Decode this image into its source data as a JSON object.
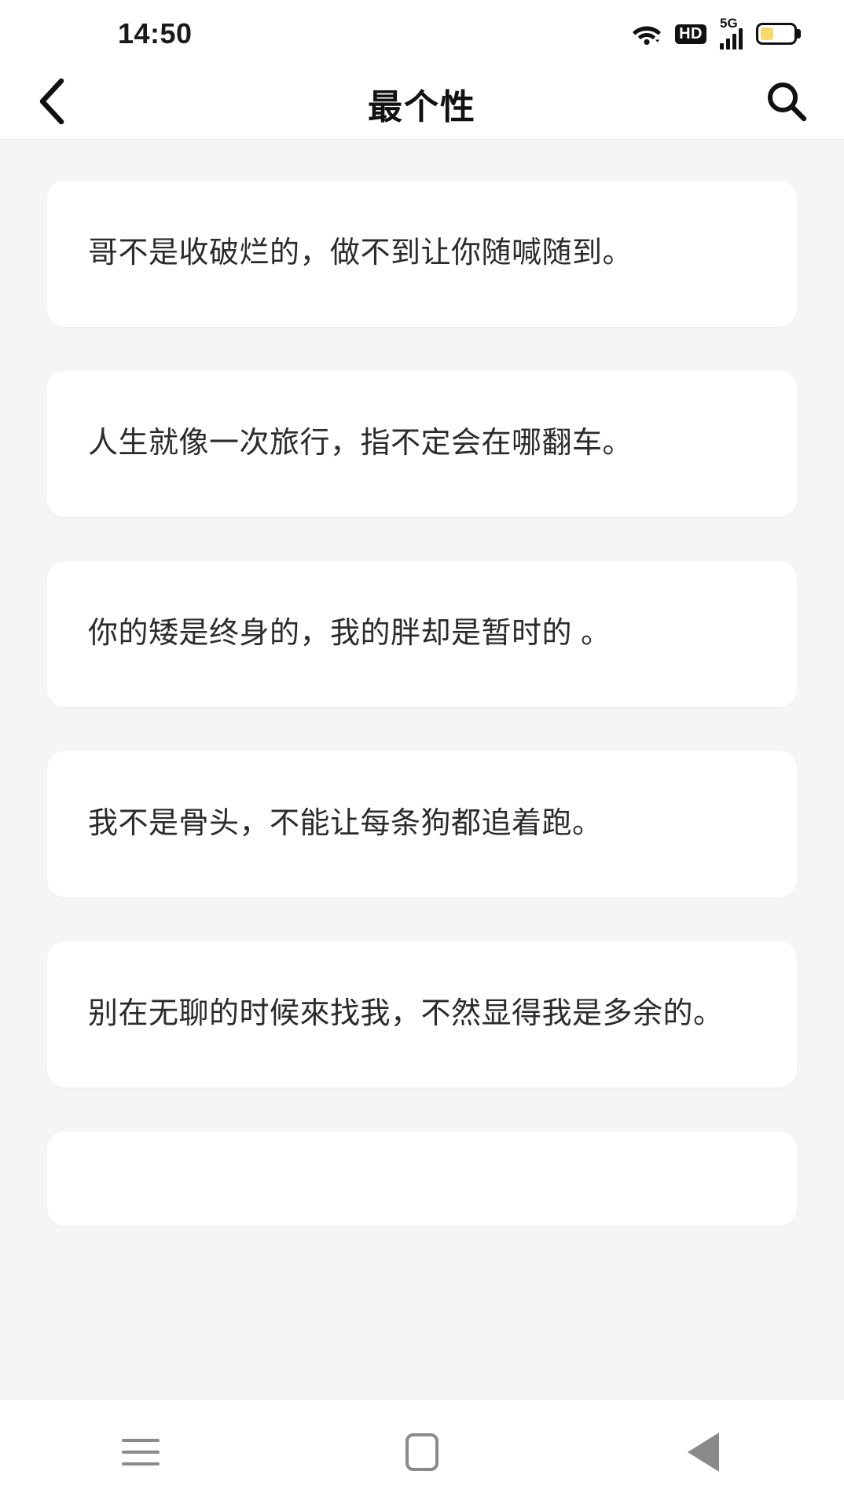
{
  "status_bar": {
    "time": "14:50",
    "icons": {
      "wifi": "wifi-icon",
      "hd": "HD",
      "network_label": "5G",
      "signal": "signal-bars-icon",
      "battery": "battery-icon",
      "battery_level_percent": 40
    }
  },
  "header": {
    "back_icon": "chevron-left-icon",
    "title": "最个性",
    "search_icon": "search-icon"
  },
  "list": {
    "items": [
      {
        "text": "哥不是收破烂的，做不到让你随喊随到。"
      },
      {
        "text": "人生就像一次旅行，指不定会在哪翻车。"
      },
      {
        "text": "你的矮是终身的，我的胖却是暂时的 。"
      },
      {
        "text": "我不是骨头，不能让每条狗都追着跑。"
      },
      {
        "text": "别在无聊的时候來找我，不然显得我是多余的。"
      },
      {
        "text": ""
      }
    ]
  },
  "nav_bar": {
    "recents_icon": "menu-icon",
    "home_icon": "home-square-icon",
    "back_icon": "back-triangle-icon"
  },
  "colors": {
    "background": "#f5f5f5",
    "card": "#ffffff",
    "text": "#2b2b2b",
    "title": "#111111",
    "battery_fill": "#f7d96b",
    "nav_icon": "#8a8a8a"
  }
}
